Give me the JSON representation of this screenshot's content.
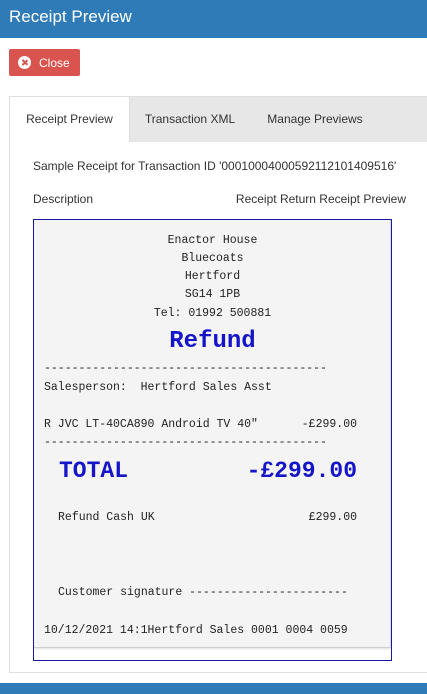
{
  "window": {
    "title": "Receipt Preview"
  },
  "toolbar": {
    "close_label": "Close"
  },
  "tabs": [
    {
      "label": "Receipt Preview",
      "active": true
    },
    {
      "label": "Transaction XML",
      "active": false
    },
    {
      "label": "Manage Previews",
      "active": false
    }
  ],
  "content": {
    "sample_text": "Sample Receipt for Transaction ID '0001000400059211210140951​6'",
    "description_label": "Description",
    "description_value": "Receipt Return Receipt Preview"
  },
  "receipt": {
    "store_name": "Enactor House",
    "address1": "Bluecoats",
    "address2": "Hertford",
    "postcode": "SG14 1PB",
    "phone": "Tel: 01992 500881",
    "heading": "Refund",
    "divider": "-----------------------------------------",
    "salesperson": "Salesperson:  Hertford Sales Asst",
    "item_desc": "R JVC LT-40CA890 Android TV 40\"",
    "item_amount": "-£299.00",
    "total_label": "TOTAL",
    "total_amount": "-£299.00",
    "tender_label": "Refund Cash UK",
    "tender_amount": "£299.00",
    "signature": "Customer signature -----------------------",
    "footer": "10/12/2021 14:1Hertford Sales 0001 0004 0059"
  },
  "colors": {
    "titlebar": "#2e7bb7",
    "close_button": "#d9534f",
    "receipt_emphasis": "#1414c8"
  }
}
